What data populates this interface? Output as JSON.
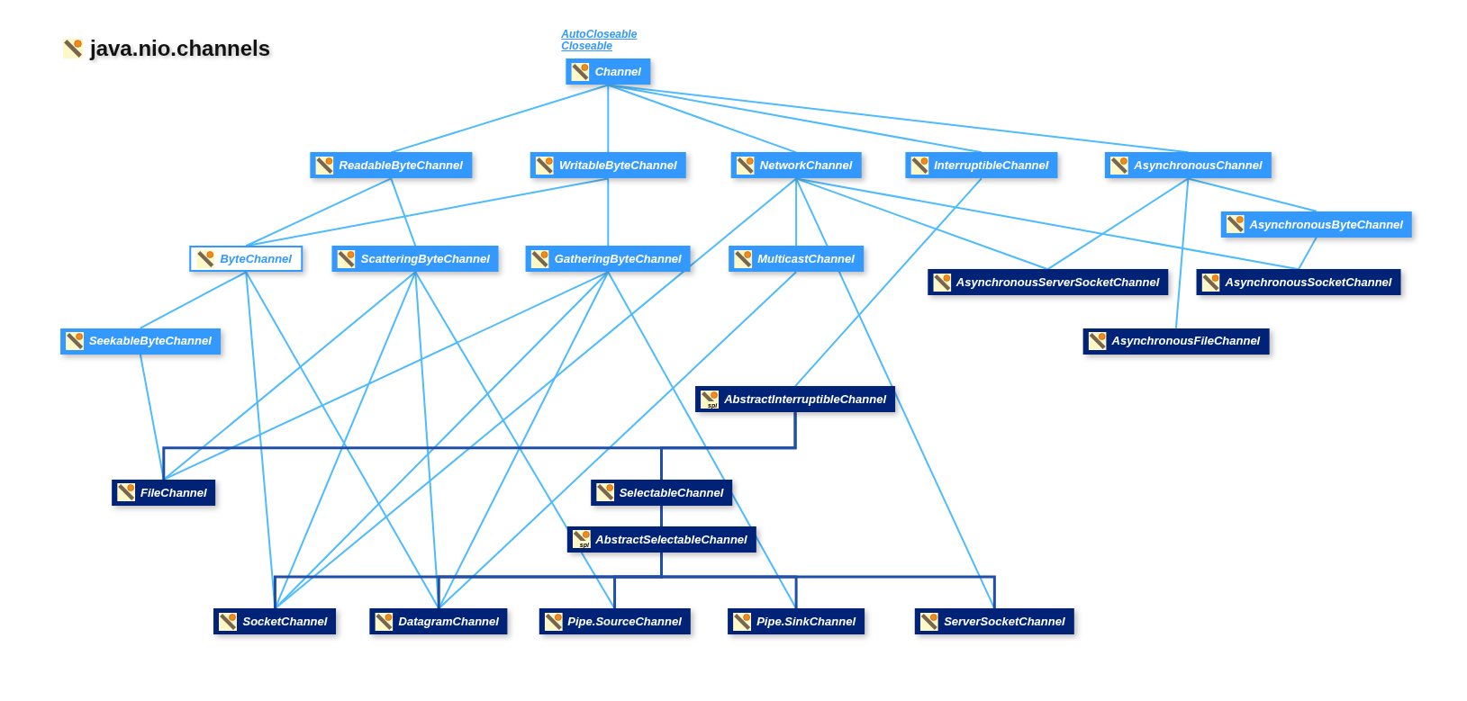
{
  "title": "java.nio.channels",
  "super_links": [
    "AutoCloseable",
    "Closeable"
  ],
  "nodes": [
    {
      "label": "Channel",
      "kind": "interface"
    },
    {
      "label": "ReadableByteChannel",
      "kind": "interface"
    },
    {
      "label": "WritableByteChannel",
      "kind": "interface"
    },
    {
      "label": "NetworkChannel",
      "kind": "interface"
    },
    {
      "label": "InterruptibleChannel",
      "kind": "interface"
    },
    {
      "label": "AsynchronousChannel",
      "kind": "interface"
    },
    {
      "label": "AsynchronousByteChannel",
      "kind": "interface"
    },
    {
      "label": "ByteChannel",
      "kind": "interface-outline"
    },
    {
      "label": "ScatteringByteChannel",
      "kind": "interface"
    },
    {
      "label": "GatheringByteChannel",
      "kind": "interface"
    },
    {
      "label": "MulticastChannel",
      "kind": "interface"
    },
    {
      "label": "AsynchronousServerSocketChannel",
      "kind": "class"
    },
    {
      "label": "AsynchronousSocketChannel",
      "kind": "class"
    },
    {
      "label": "SeekableByteChannel",
      "kind": "interface"
    },
    {
      "label": "AsynchronousFileChannel",
      "kind": "class"
    },
    {
      "label": "AbstractInterruptibleChannel",
      "kind": "class",
      "badge": "spi"
    },
    {
      "label": "FileChannel",
      "kind": "class"
    },
    {
      "label": "SelectableChannel",
      "kind": "class"
    },
    {
      "label": "AbstractSelectableChannel",
      "kind": "class",
      "badge": "spi"
    },
    {
      "label": "SocketChannel",
      "kind": "class"
    },
    {
      "label": "DatagramChannel",
      "kind": "class"
    },
    {
      "label": "Pipe.SourceChannel",
      "kind": "class"
    },
    {
      "label": "Pipe.SinkChannel",
      "kind": "class"
    },
    {
      "label": "ServerSocketChannel",
      "kind": "class"
    }
  ]
}
